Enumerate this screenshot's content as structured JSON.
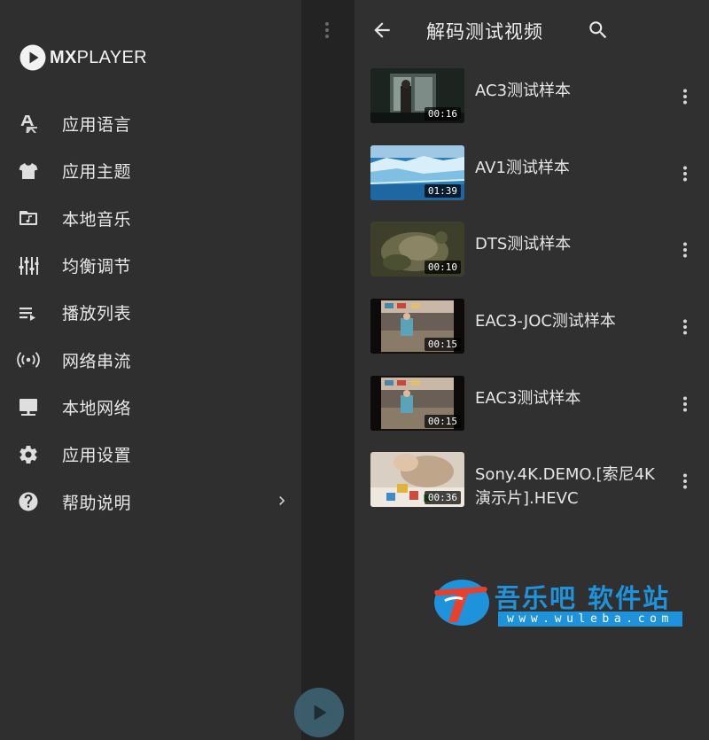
{
  "app": {
    "logo_text_bold": "MX",
    "logo_text_light": "PLAYER"
  },
  "drawer": {
    "items": [
      {
        "label": "应用语言",
        "icon": "language-icon"
      },
      {
        "label": "应用主题",
        "icon": "shirt-icon"
      },
      {
        "label": "本地音乐",
        "icon": "music-folder-icon"
      },
      {
        "label": "均衡调节",
        "icon": "equalizer-icon"
      },
      {
        "label": "播放列表",
        "icon": "playlist-icon"
      },
      {
        "label": "网络串流",
        "icon": "stream-icon"
      },
      {
        "label": "本地网络",
        "icon": "local-network-icon"
      },
      {
        "label": "应用设置",
        "icon": "gear-icon"
      },
      {
        "label": "帮助说明",
        "icon": "help-icon",
        "has_chevron": true
      }
    ]
  },
  "header": {
    "title": "解码测试视频"
  },
  "videos": [
    {
      "title": "AC3测试样本",
      "duration": "00:16"
    },
    {
      "title": "AV1测试样本",
      "duration": "01:39"
    },
    {
      "title": "DTS测试样本",
      "duration": "00:10"
    },
    {
      "title": "EAC3-JOC测试样本",
      "duration": "00:15"
    },
    {
      "title": "EAC3测试样本",
      "duration": "00:15"
    },
    {
      "title": "Sony.4K.DEMO.[索尼4K演示片].HEVC",
      "duration": "00:36"
    }
  ],
  "watermark": {
    "name": "吾乐吧 软件站",
    "url": "www.wuleba.com"
  },
  "colors": {
    "drawer_bg": "#2f2f2f",
    "strip_bg": "#232323",
    "panel_bg": "#303030",
    "watermark_blue": "#1f92dc",
    "watermark_red": "#e8402c"
  }
}
